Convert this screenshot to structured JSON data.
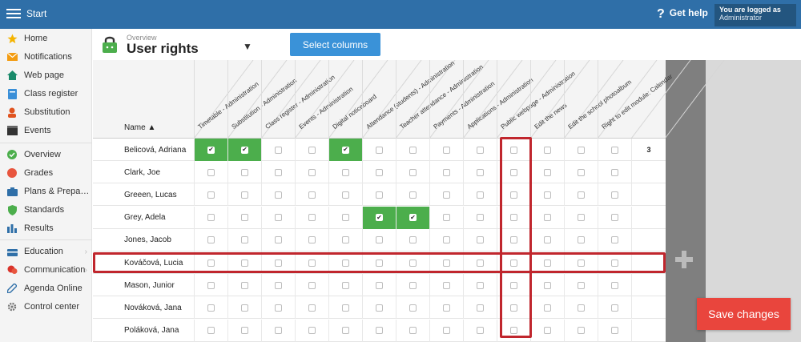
{
  "topbar": {
    "title": "Start",
    "help_label": "Get help",
    "user_line1": "You are logged as",
    "user_line2": "Administrator"
  },
  "sidebar": {
    "items": [
      {
        "label": "Home",
        "icon": "star-icon"
      },
      {
        "label": "Notifications",
        "icon": "envelope-icon"
      },
      {
        "label": "Web page",
        "icon": "house-icon"
      },
      {
        "label": "Class register",
        "icon": "book-icon"
      },
      {
        "label": "Substitution",
        "icon": "person-icon"
      },
      {
        "label": "Events",
        "icon": "clapperboard-icon"
      },
      {
        "label": "Overview",
        "icon": "check-circle-icon"
      },
      {
        "label": "Grades",
        "icon": "grade-badge-icon"
      },
      {
        "label": "Plans & Prepar...",
        "icon": "briefcase-icon"
      },
      {
        "label": "Standards",
        "icon": "shield-icon"
      },
      {
        "label": "Results",
        "icon": "bar-chart-icon"
      },
      {
        "label": "Education",
        "icon": "education-icon"
      },
      {
        "label": "Communication",
        "icon": "chat-icon"
      },
      {
        "label": "Agenda Online",
        "icon": "pen-icon"
      },
      {
        "label": "Control center",
        "icon": "gear-icon"
      }
    ]
  },
  "header": {
    "breadcrumb": "Overview",
    "title": "User rights",
    "select_columns_label": "Select columns"
  },
  "table": {
    "name_header": "Name ▲",
    "columns": [
      "Timetable - Administration",
      "Substitution - Administration",
      "Class register - Administration",
      "Events - Administration",
      "Digital noticeboard",
      "Attendance (students) - Administration",
      "Teacher attendance - Administration",
      "Payments - Administration",
      "Applications - Administration",
      "Public webpage - Administration",
      "Edit the news",
      "Edit the school photoalbum",
      "Right to edit module: Calendar"
    ],
    "rows": [
      {
        "name": "Belicová, Adriana",
        "checks": [
          1,
          1,
          0,
          0,
          1,
          0,
          0,
          0,
          0,
          0,
          0,
          0,
          0
        ],
        "count": "3"
      },
      {
        "name": "Clark, Joe",
        "checks": [
          0,
          0,
          0,
          0,
          0,
          0,
          0,
          0,
          0,
          0,
          0,
          0,
          0
        ],
        "count": ""
      },
      {
        "name": "Greeen, Lucas",
        "checks": [
          0,
          0,
          0,
          0,
          0,
          0,
          0,
          0,
          0,
          0,
          0,
          0,
          0
        ],
        "count": ""
      },
      {
        "name": "Grey, Adela",
        "checks": [
          0,
          0,
          0,
          0,
          0,
          1,
          1,
          0,
          0,
          0,
          0,
          0,
          0
        ],
        "count": ""
      },
      {
        "name": "Jones, Jacob",
        "checks": [
          0,
          0,
          0,
          0,
          0,
          0,
          0,
          0,
          0,
          0,
          0,
          0,
          0
        ],
        "count": ""
      },
      {
        "name": "Kováčová, Lucia",
        "checks": [
          0,
          0,
          0,
          0,
          0,
          0,
          0,
          0,
          0,
          0,
          0,
          0,
          0
        ],
        "count": ""
      },
      {
        "name": "Mason, Junior",
        "checks": [
          0,
          0,
          0,
          0,
          0,
          0,
          0,
          0,
          0,
          0,
          0,
          0,
          0
        ],
        "count": ""
      },
      {
        "name": "Nováková, Jana",
        "checks": [
          0,
          0,
          0,
          0,
          0,
          0,
          0,
          0,
          0,
          0,
          0,
          0,
          0
        ],
        "count": ""
      },
      {
        "name": "Poláková, Jana",
        "checks": [
          0,
          0,
          0,
          0,
          0,
          0,
          0,
          0,
          0,
          0,
          0,
          0,
          0
        ],
        "count": ""
      }
    ]
  },
  "save_label": "Save changes",
  "colors": {
    "topbar": "#2f6fa8",
    "checked_cell": "#4cae4c",
    "highlight": "#c0262d",
    "save_button": "#e9453d",
    "select_button": "#3a92d8"
  }
}
